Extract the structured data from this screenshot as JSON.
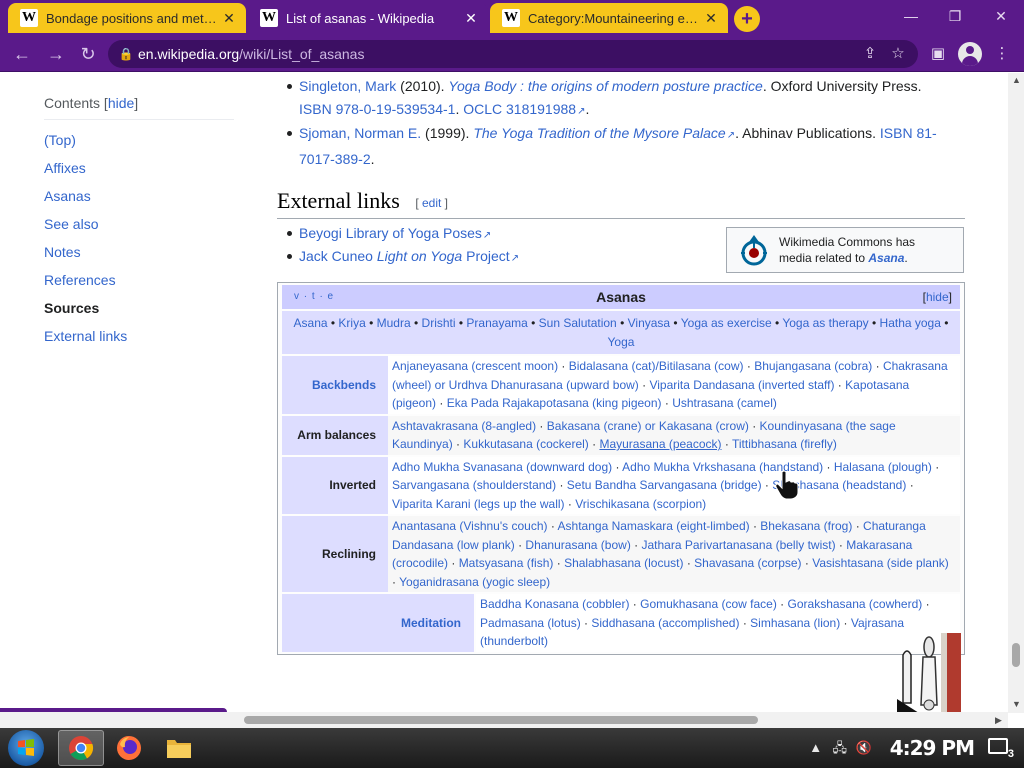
{
  "browser": {
    "tabs": [
      {
        "title": "Bondage positions and methods",
        "favicon": "W",
        "state": "inactive"
      },
      {
        "title": "List of asanas - Wikipedia",
        "favicon": "W",
        "state": "active"
      },
      {
        "title": "Category:Mountaineering equipment",
        "favicon": "W",
        "state": "inactive"
      }
    ],
    "new_tab_label": "+",
    "url_host": "en.wikipedia.org",
    "url_path": "/wiki/List_of_asanas",
    "status_url": "https://en.wikipedia.org/wiki/Mayurasana",
    "theme_color": "#5a1a8a",
    "tab_color": "#f7c61b"
  },
  "toc": {
    "title": "Contents",
    "toggle": "hide",
    "items": [
      "(Top)",
      "Affixes",
      "Asanas",
      "See also",
      "Notes",
      "References",
      "Sources",
      "External links"
    ],
    "current": "Sources"
  },
  "sources": [
    {
      "author": "Singleton, Mark",
      "year": " (2010). ",
      "title": "Yoga Body : the origins of modern posture practice",
      "publisher": ". Oxford University Press.",
      "isbn": "ISBN 978-0-19-539534-1",
      "oclc": "OCLC 318191988"
    },
    {
      "author": "Sjoman, Norman E.",
      "year": " (1999). ",
      "title": "The Yoga Tradition of the Mysore Palace",
      "publisher": ". Abhinav Publications.",
      "isbn": "ISBN 81-7017-389-2"
    }
  ],
  "external_links": {
    "heading": "External links",
    "edit": "edit",
    "items": [
      {
        "text": "Beyogi Library of Yoga Poses"
      },
      {
        "text_a": "Jack Cuneo ",
        "text_italic": "Light on Yoga",
        "text_b": " Project"
      }
    ]
  },
  "commons": {
    "line1": "Wikimedia Commons has",
    "line2": "media related to ",
    "link": "Asana",
    "end": "."
  },
  "navbox": {
    "vte": "v · t · e",
    "title": "Asanas",
    "hide": "hide",
    "top_links": [
      "Asana",
      "Kriya",
      "Mudra",
      "Drishti",
      "Pranayama",
      "Sun Salutation",
      "Vinyasa",
      "Yoga as exercise",
      "Yoga as therapy",
      "Hatha yoga",
      "Yoga"
    ],
    "groups": [
      {
        "name": "Backbends",
        "is_link": true,
        "items": [
          "Anjaneyasana (crescent moon)",
          "Bidalasana (cat)/Bitilasana (cow)",
          "Bhujangasana (cobra)",
          "Chakrasana (wheel) or Urdhva Dhanurasana (upward bow)",
          "Viparita Dandasana (inverted staff)",
          "Kapotasana (pigeon)",
          "Eka Pada Rajakapotasana (king pigeon)",
          "Ushtrasana (camel)"
        ]
      },
      {
        "name": "Arm balances",
        "is_link": false,
        "items": [
          "Ashtavakrasana (8-angled)",
          "Bakasana (crane) or Kakasana (crow)",
          "Koundinyasana (the sage Kaundinya)",
          "Kukkutasana (cockerel)",
          "Mayurasana (peacock)",
          "Tittibhasana (firefly)"
        ]
      },
      {
        "name": "Inverted",
        "is_link": false,
        "items": [
          "Adho Mukha Svanasana (downward dog)",
          "Adho Mukha Vrkshasana (handstand)",
          "Halasana (plough)",
          "Sarvangasana (shoulderstand)",
          "Setu Bandha Sarvangasana (bridge)",
          "Shirshasana (headstand)",
          "Viparita Karani (legs up the wall)",
          "Vrischikasana (scorpion)"
        ]
      },
      {
        "name": "Reclining",
        "is_link": false,
        "items": [
          "Anantasana (Vishnu's couch)",
          "Ashtanga Namaskara (eight-limbed)",
          "Bhekasana (frog)",
          "Chaturanga Dandasana (low plank)",
          "Dhanurasana (bow)",
          "Jathara Parivartanasana (belly twist)",
          "Makarasana (crocodile)",
          "Matsyasana (fish)",
          "Shalabhasana (locust)",
          "Shavasana (corpse)",
          "Vasishtasana (side plank)",
          "Yoganidrasana (yogic sleep)"
        ]
      }
    ],
    "sitting": {
      "subgroup": "Meditation",
      "items": [
        "Baddha Konasana (cobbler)",
        "Gomukhasana (cow face)",
        "Gorakshasana (cowherd)",
        "Padmasana (lotus)",
        "Siddhasana (accomplished)",
        "Simhasana (lion)",
        "Vajrasana (thunderbolt)"
      ]
    }
  },
  "taskbar": {
    "clock": "4:29 PM",
    "notification_count": "3"
  }
}
